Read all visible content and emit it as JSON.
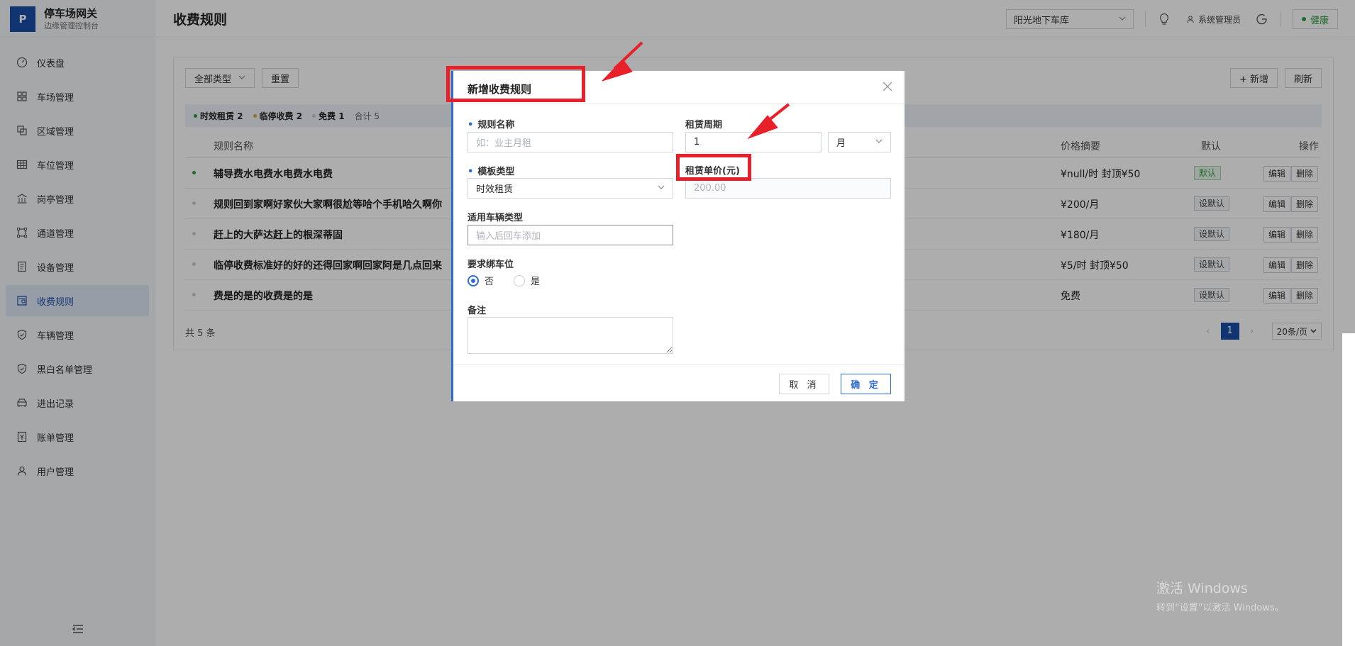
{
  "brand": {
    "logo": "P",
    "title": "停车场网关",
    "subtitle": "边缘管理控制台"
  },
  "sidebar": {
    "items": [
      {
        "label": "仪表盘",
        "icon": "dashboard-icon",
        "active": false
      },
      {
        "label": "车场管理",
        "icon": "grid-icon",
        "active": false
      },
      {
        "label": "区域管理",
        "icon": "layers-icon",
        "active": false
      },
      {
        "label": "车位管理",
        "icon": "table-icon",
        "active": false
      },
      {
        "label": "岗亭管理",
        "icon": "building-icon",
        "active": false
      },
      {
        "label": "通道管理",
        "icon": "channel-icon",
        "active": false
      },
      {
        "label": "设备管理",
        "icon": "device-icon",
        "active": false
      },
      {
        "label": "收费规则",
        "icon": "billing-icon",
        "active": true
      },
      {
        "label": "车辆管理",
        "icon": "shield-icon",
        "active": false
      },
      {
        "label": "黑白名单管理",
        "icon": "shield-icon",
        "active": false
      },
      {
        "label": "进出记录",
        "icon": "car-icon",
        "active": false
      },
      {
        "label": "账单管理",
        "icon": "bill-icon",
        "active": false
      },
      {
        "label": "用户管理",
        "icon": "user-icon",
        "active": false
      }
    ]
  },
  "header": {
    "title": "收费规则",
    "garage": "阳光地下车库",
    "admin": "系统管理员",
    "health": "健康"
  },
  "toolbar": {
    "type_filter": "全部类型",
    "reset": "重置",
    "add": "+ 新增",
    "refresh": "刷新"
  },
  "stats": {
    "timed": "时效租赁 2",
    "temp": "临停收费 2",
    "free": "免费 1",
    "total": "合计 5"
  },
  "table": {
    "headers": {
      "name": "规则名称",
      "price": "价格摘要",
      "default": "默认",
      "ops": "操作"
    },
    "rows": [
      {
        "name": "辅导费水电费水电费水电费",
        "price": "¥null/时 封顶¥50",
        "badge": "默认",
        "edit": "编辑",
        "del": "删除"
      },
      {
        "name": "规则回到家啊好家伙大家啊很尬等哈个手机哈久啊你",
        "price": "¥200/月",
        "badge": "设默认",
        "edit": "编辑",
        "del": "删除"
      },
      {
        "name": "赶上的大萨达赶上的根深蒂固",
        "price": "¥180/月",
        "badge": "设默认",
        "edit": "编辑",
        "del": "删除"
      },
      {
        "name": "临停收费标准好的好的还得回家啊回家阿是几点回来",
        "price": "¥5/时 封顶¥50",
        "badge": "设默认",
        "edit": "编辑",
        "del": "删除"
      },
      {
        "name": "费是的是的收费是的是",
        "price": "免费",
        "badge": "设默认",
        "edit": "编辑",
        "del": "删除"
      }
    ],
    "total": "共 5 条",
    "page": "1",
    "page_size": "20条/页"
  },
  "modal": {
    "title": "新增收费规则",
    "fields": {
      "rule_name_label": "规则名称",
      "rule_name_placeholder": "如：业主月租",
      "period_label": "租赁周期",
      "period_value": "1",
      "period_unit": "月",
      "template_label": "模板类型",
      "template_value": "时效租赁",
      "unit_price_label": "租赁单价(元)",
      "unit_price_placeholder": "200.00",
      "vehicle_type_label": "适用车辆类型",
      "vehicle_type_placeholder": "输入后回车添加",
      "bind_label": "要求绑车位",
      "bind_no": "否",
      "bind_yes": "是",
      "remark_label": "备注"
    },
    "cancel": "取 消",
    "ok": "确 定"
  },
  "watermark": {
    "line1": "激活 Windows",
    "line2": "转到“设置”以激活 Windows。"
  },
  "colors": {
    "primary": "#1a4ea8",
    "accent": "#2f6bd8",
    "success": "#2e9d3e",
    "warning": "#e8a23a",
    "annotation": "#e8202a"
  }
}
